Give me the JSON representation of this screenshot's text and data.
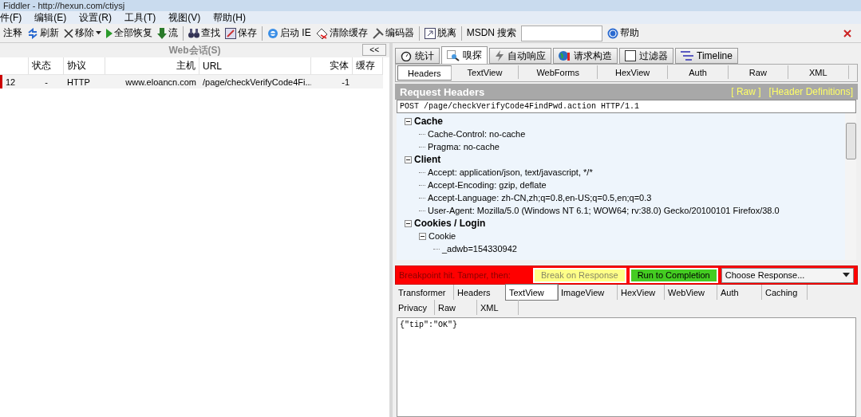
{
  "window": {
    "title": "Fiddler - http://hexun.com/ctiysj"
  },
  "menu": [
    "件(F)",
    "编辑(E)",
    "设置(R)",
    "工具(T)",
    "视图(V)",
    "帮助(H)"
  ],
  "toolbar": [
    {
      "kind": "text",
      "label": "注释"
    },
    {
      "kind": "refresh",
      "label": "刷新"
    },
    {
      "kind": "remove",
      "label": "移除"
    },
    {
      "kind": "play",
      "label": "全部恢复"
    },
    {
      "kind": "stream",
      "label": "流"
    },
    {
      "kind": "find",
      "label": "查找"
    },
    {
      "kind": "save",
      "label": "保存"
    },
    {
      "kind": "ie",
      "label": "启动 IE"
    },
    {
      "kind": "clear",
      "label": "清除缓存"
    },
    {
      "kind": "tools",
      "label": "编码器"
    },
    {
      "kind": "detach",
      "label": "脱离"
    }
  ],
  "msdn_search": {
    "label": "MSDN 搜索"
  },
  "help": "帮助",
  "sessions": {
    "title": "Web会话(S)",
    "collapse": "<<",
    "columns": [
      "状态",
      "协议",
      "主机",
      "URL",
      "实体",
      "缓存"
    ],
    "rows": [
      {
        "id": "12",
        "status": "-",
        "protocol": "HTTP",
        "host": "www.eloancn.com",
        "url": "/page/checkVerifyCode4Fi...",
        "body": "-1",
        "caching": ""
      }
    ]
  },
  "main_tabs": [
    {
      "kind": "timer",
      "label": "统计",
      "selected": false
    },
    {
      "kind": "inspect",
      "label": "嗅探",
      "selected": true
    },
    {
      "kind": "bolt",
      "label": "自动响应",
      "selected": false
    },
    {
      "kind": "globe",
      "label": "请求构造",
      "selected": false
    },
    {
      "kind": "box",
      "label": "过滤器",
      "selected": false
    },
    {
      "kind": "timeline",
      "label": "Timeline",
      "selected": false
    }
  ],
  "request_tabs": [
    {
      "label": "Headers",
      "selected": true
    },
    {
      "label": "TextView",
      "selected": false
    },
    {
      "label": "WebForms",
      "selected": false
    },
    {
      "label": "HexView",
      "selected": false
    },
    {
      "label": "Auth",
      "selected": false
    },
    {
      "label": "Raw",
      "selected": false
    },
    {
      "label": "XML",
      "selected": false
    }
  ],
  "request_headers": {
    "title": "Request Headers",
    "links": [
      "[ Raw ]",
      "[Header Definitions]"
    ],
    "request_line": "POST /page/checkVerifyCode4FindPwd.action HTTP/1.1",
    "tree": [
      {
        "label": "Cache",
        "expanded": true,
        "children": [
          {
            "label": "Cache-Control: no-cache"
          },
          {
            "label": "Pragma: no-cache"
          }
        ]
      },
      {
        "label": "Client",
        "expanded": true,
        "children": [
          {
            "label": "Accept: application/json, text/javascript, */*"
          },
          {
            "label": "Accept-Encoding: gzip, deflate"
          },
          {
            "label": "Accept-Language: zh-CN,zh;q=0.8,en-US;q=0.5,en;q=0.3"
          },
          {
            "label": "User-Agent: Mozilla/5.0 (Windows NT 6.1; WOW64; rv:38.0) Gecko/20100101 Firefox/38.0"
          }
        ]
      },
      {
        "label": "Cookies / Login",
        "expanded": true,
        "children": [
          {
            "label": "Cookie",
            "expanded": true,
            "children": [
              {
                "label": "_adwb=154330942"
              }
            ]
          }
        ]
      }
    ]
  },
  "breakpoint": {
    "message": "Breakpoint hit.  Tamper, then:",
    "buttons": [
      {
        "kind": "break",
        "label": "Break on Response"
      },
      {
        "kind": "run",
        "label": "Run to Completion"
      }
    ],
    "choose": "Choose Response..."
  },
  "response_tabs": [
    {
      "label": "Transformer",
      "selected": false
    },
    {
      "label": "Headers",
      "selected": false
    },
    {
      "label": "TextView",
      "selected": true
    },
    {
      "label": "ImageView",
      "selected": false
    },
    {
      "label": "HexView",
      "selected": false
    },
    {
      "label": "WebView",
      "selected": false
    },
    {
      "label": "Auth",
      "selected": false
    },
    {
      "label": "Caching",
      "selected": false
    },
    {
      "label": "Privacy",
      "selected": false
    },
    {
      "label": "Raw",
      "selected": false
    },
    {
      "label": "XML",
      "selected": false
    }
  ],
  "response_body": "{\"tip\":\"OK\"}"
}
